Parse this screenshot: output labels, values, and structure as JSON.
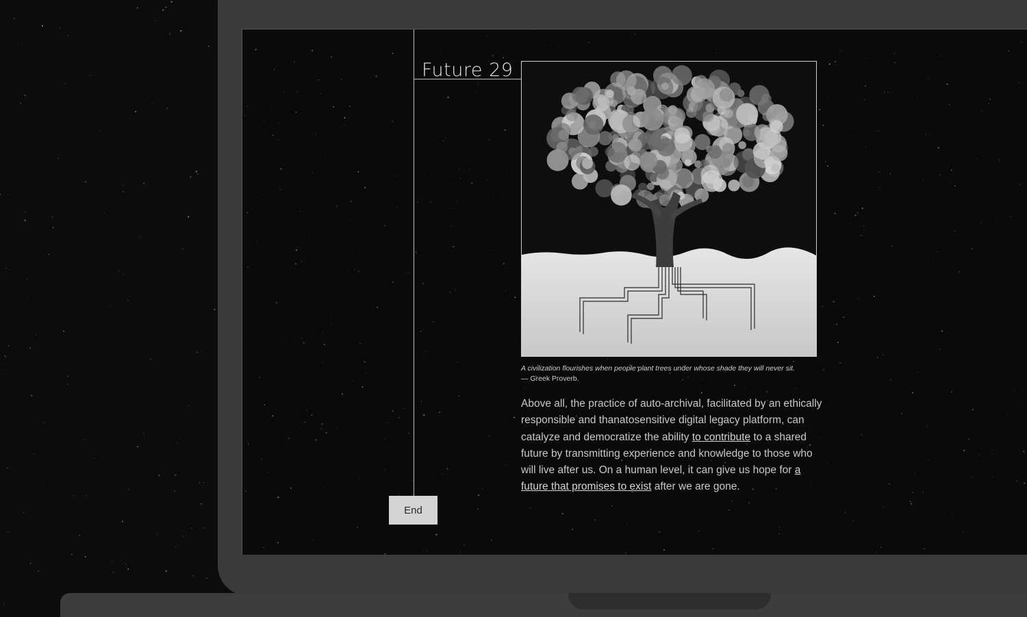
{
  "page": {
    "title": "Future 29",
    "caption_quote": "A civilization flourishes when people plant trees under whose shade they will never sit.",
    "caption_source": "— Greek Proverb.",
    "paragraph": {
      "part1": "Above all, the practice of auto-archival, facilitated by an ethically responsible and thanatosensitive digital legacy platform, can catalyze and democratize the ability ",
      "link1": "to contribute",
      "part2": " to a shared future by transmitting experience and knowledge to those who will live after us. On a human level, it can give us hope for ",
      "link2": "a future that promises to exist",
      "part3": " after we are gone."
    },
    "end_button": "End"
  },
  "colors": {
    "background": "#0c0c0c",
    "laptop_body": "#3a3a3a",
    "screen": "#0a0a0a",
    "text": "#c9c9c9",
    "button": "#d4d4d4"
  },
  "icons": {
    "illustration": "tree-with-circuit-roots"
  }
}
